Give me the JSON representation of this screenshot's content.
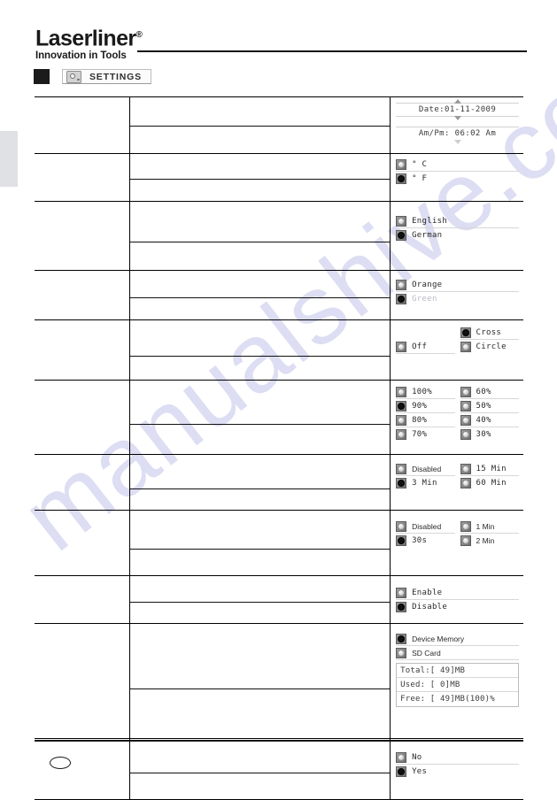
{
  "brand": {
    "name": "Laserliner",
    "registered": "®",
    "tagline": "Innovation in Tools"
  },
  "section": {
    "title": "SETTINGS",
    "icon": "camera-icon",
    "marker_color": "#1b1b1b"
  },
  "watermark": {
    "text": "manualshive.com",
    "color": "#d8d8f2"
  },
  "page": {
    "number": ""
  },
  "screens": [
    {
      "id": "date-time",
      "date_label": "Date:01-11-2009",
      "time_label": "Am/Pm:  06:02  Am",
      "spinner_up": "up-arrow",
      "spinner_down": "down-arrow"
    },
    {
      "id": "temperature-unit",
      "options": [
        {
          "label": "° C",
          "selected": false
        },
        {
          "label": "° F",
          "selected": true
        }
      ]
    },
    {
      "id": "language",
      "options": [
        {
          "label": "English",
          "selected": false
        },
        {
          "label": "German",
          "selected": true
        }
      ]
    },
    {
      "id": "color-palette",
      "options": [
        {
          "label": "Orange",
          "selected": false
        },
        {
          "label": "Green",
          "selected": true,
          "faint": true
        }
      ]
    },
    {
      "id": "crosshair",
      "left_options": [
        {
          "label": "Off",
          "selected": false
        }
      ],
      "right_options": [
        {
          "label": "Cross",
          "selected": true
        },
        {
          "label": "Circle",
          "selected": false
        }
      ]
    },
    {
      "id": "brightness",
      "left_options": [
        {
          "label": "100%",
          "selected": false
        },
        {
          "label": "90%",
          "selected": true
        },
        {
          "label": "80%",
          "selected": false
        },
        {
          "label": "70%",
          "selected": false
        }
      ],
      "right_options": [
        {
          "label": "60%",
          "selected": false
        },
        {
          "label": "50%",
          "selected": false
        },
        {
          "label": "40%",
          "selected": false
        },
        {
          "label": "30%",
          "selected": false
        }
      ]
    },
    {
      "id": "auto-power-off",
      "left_options": [
        {
          "label": "Disabled",
          "selected": false
        },
        {
          "label": "3 Min",
          "selected": true
        }
      ],
      "right_options": [
        {
          "label": "15 Min",
          "selected": false
        },
        {
          "label": "60 Min",
          "selected": false
        }
      ]
    },
    {
      "id": "backlight-timeout",
      "left_options": [
        {
          "label": "Disabled",
          "selected": false
        },
        {
          "label": "30s",
          "selected": true
        }
      ],
      "right_options": [
        {
          "label": "1 Min",
          "selected": false
        },
        {
          "label": "2 Min",
          "selected": false
        }
      ]
    },
    {
      "id": "enable-disable",
      "options": [
        {
          "label": "Enable",
          "selected": false
        },
        {
          "label": "Disable",
          "selected": true
        }
      ]
    },
    {
      "id": "storage-location",
      "options": [
        {
          "label": "Device Memory",
          "selected": true
        },
        {
          "label": "SD Card",
          "selected": false
        }
      ]
    },
    {
      "id": "memory-info",
      "rows": [
        "Total:[   49]MB",
        "Used: [    0]MB",
        "Free: [   49]MB(100)%"
      ]
    },
    {
      "id": "confirm",
      "options": [
        {
          "label": "No",
          "selected": false
        },
        {
          "label": "Yes",
          "selected": true
        }
      ]
    }
  ]
}
